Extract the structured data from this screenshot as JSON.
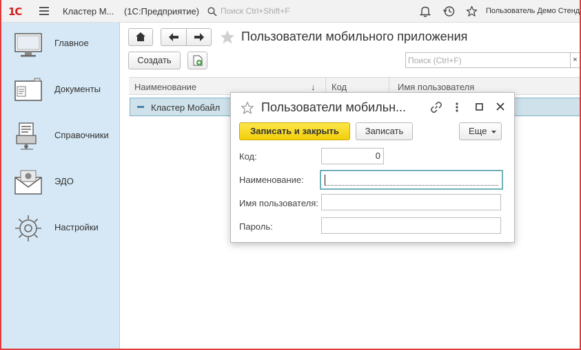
{
  "topbar": {
    "logo": "1С",
    "app_title": "Кластер М...",
    "app_sub": "(1С:Предприятие)",
    "search_placeholder": "Поиск Ctrl+Shift+F",
    "user_name": "Пользователь Демо Стенд"
  },
  "sidebar": {
    "items": [
      {
        "label": "Главное",
        "icon": "monitor-icon"
      },
      {
        "label": "Документы",
        "icon": "documents-icon"
      },
      {
        "label": "Справочники",
        "icon": "directories-icon"
      },
      {
        "label": "ЭДО",
        "icon": "edo-envelope-icon"
      },
      {
        "label": "Настройки",
        "icon": "gear-icon"
      }
    ]
  },
  "page": {
    "title": "Пользователи мобильного приложения",
    "create_label": "Создать",
    "search_placeholder": "Поиск (Ctrl+F)",
    "clear_label": "×"
  },
  "table": {
    "columns": [
      "Наименование",
      "Код",
      "Имя пользователя"
    ],
    "sort_indicator": "↓",
    "rows": [
      {
        "name": "Кластер Мобайл"
      }
    ]
  },
  "dialog": {
    "title": "Пользователи мобильн...",
    "save_close_label": "Записать и закрыть",
    "save_label": "Записать",
    "more_label": "Еще",
    "fields": {
      "code_label": "Код:",
      "code_value": "0",
      "name_label": "Наименование:",
      "name_value": "",
      "username_label": "Имя пользователя:",
      "username_value": "",
      "password_label": "Пароль:",
      "password_value": ""
    }
  },
  "colors": {
    "sidebar_bg": "#d6e8f5",
    "primary_button": "#f2cf0a",
    "selection": "#cfe2ec",
    "frame": "#e03a3a"
  }
}
